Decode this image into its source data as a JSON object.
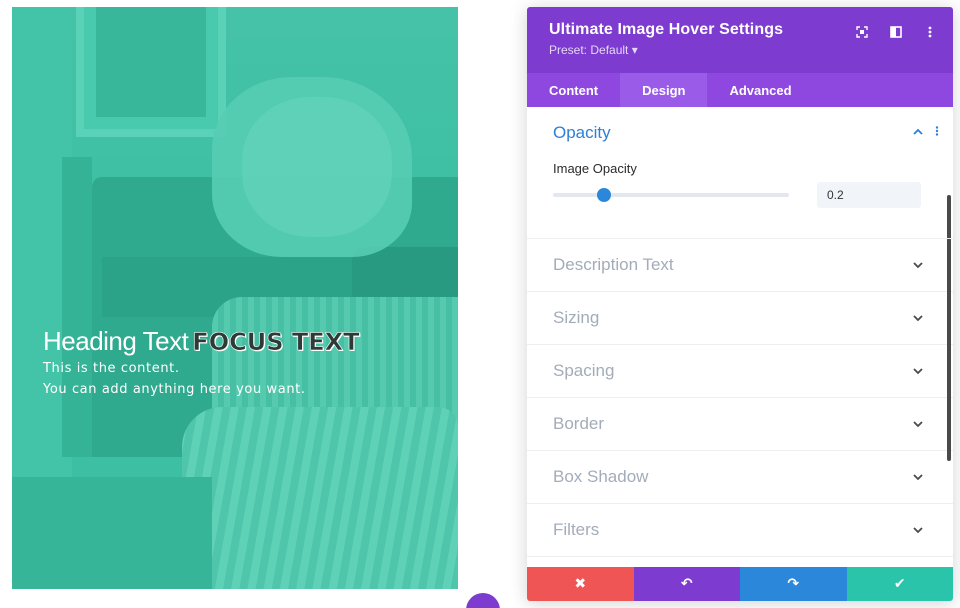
{
  "preview": {
    "heading_light": "Heading Text",
    "heading_focus": "FOCUS TEXT",
    "content_lines": [
      "This is the content.",
      "You can add anything here you want."
    ]
  },
  "panel": {
    "title": "Ultimate Image Hover Settings",
    "preset": "Preset: Default ▾",
    "header_icons": [
      "focus-icon",
      "split-view-icon",
      "more-vertical-icon"
    ],
    "tabs": [
      {
        "label": "Content",
        "active": false
      },
      {
        "label": "Design",
        "active": true
      },
      {
        "label": "Advanced",
        "active": false
      }
    ],
    "open_section": {
      "title": "Opacity",
      "field_label": "Image Opacity",
      "value": "0.2",
      "slider_fraction": 0.2
    },
    "sections": [
      {
        "title": "Description Text"
      },
      {
        "title": "Sizing"
      },
      {
        "title": "Spacing"
      },
      {
        "title": "Border"
      },
      {
        "title": "Box Shadow"
      },
      {
        "title": "Filters"
      }
    ],
    "footer": {
      "cancel": "✖",
      "undo": "↶",
      "redo": "↷",
      "save": "✔"
    }
  },
  "colors": {
    "accent_purple": "#7d3bcf",
    "tab_purple": "#8e48e0",
    "link_blue": "#2f7fd6",
    "cancel_red": "#ef5555",
    "undo_purple": "#7d3bcf",
    "redo_blue": "#2b87da",
    "save_green": "#29c4a9",
    "preview_teal": "#3cbfa3"
  }
}
